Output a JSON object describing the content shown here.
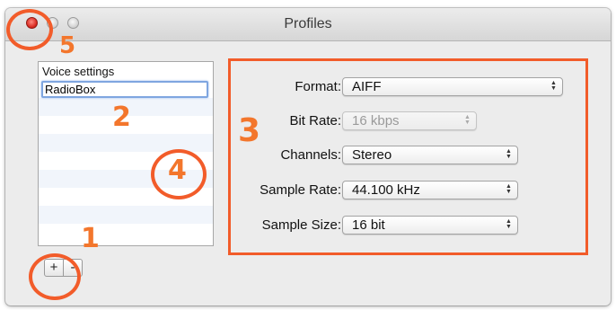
{
  "window": {
    "title": "Profiles"
  },
  "profiles_list": {
    "items": [
      "Voice settings"
    ],
    "editing_value": "RadioBox"
  },
  "list_buttons": {
    "add_label": "+",
    "remove_label": "-"
  },
  "settings": {
    "format": {
      "label": "Format:",
      "value": "AIFF",
      "enabled": true
    },
    "bit_rate": {
      "label": "Bit Rate:",
      "value": "16 kbps",
      "enabled": false
    },
    "channels": {
      "label": "Channels:",
      "value": "Stereo",
      "enabled": true
    },
    "sample_rate": {
      "label": "Sample Rate:",
      "value": "44.100 kHz",
      "enabled": true
    },
    "sample_size": {
      "label": "Sample Size:",
      "value": "16 bit",
      "enabled": true
    }
  },
  "callouts": {
    "one": "1",
    "two": "2",
    "three": "3",
    "four": "4",
    "five": "5"
  },
  "colors": {
    "callout": "#f25c2a",
    "close_button": "#d8281f",
    "edit_focus": "#7fa6e0"
  }
}
